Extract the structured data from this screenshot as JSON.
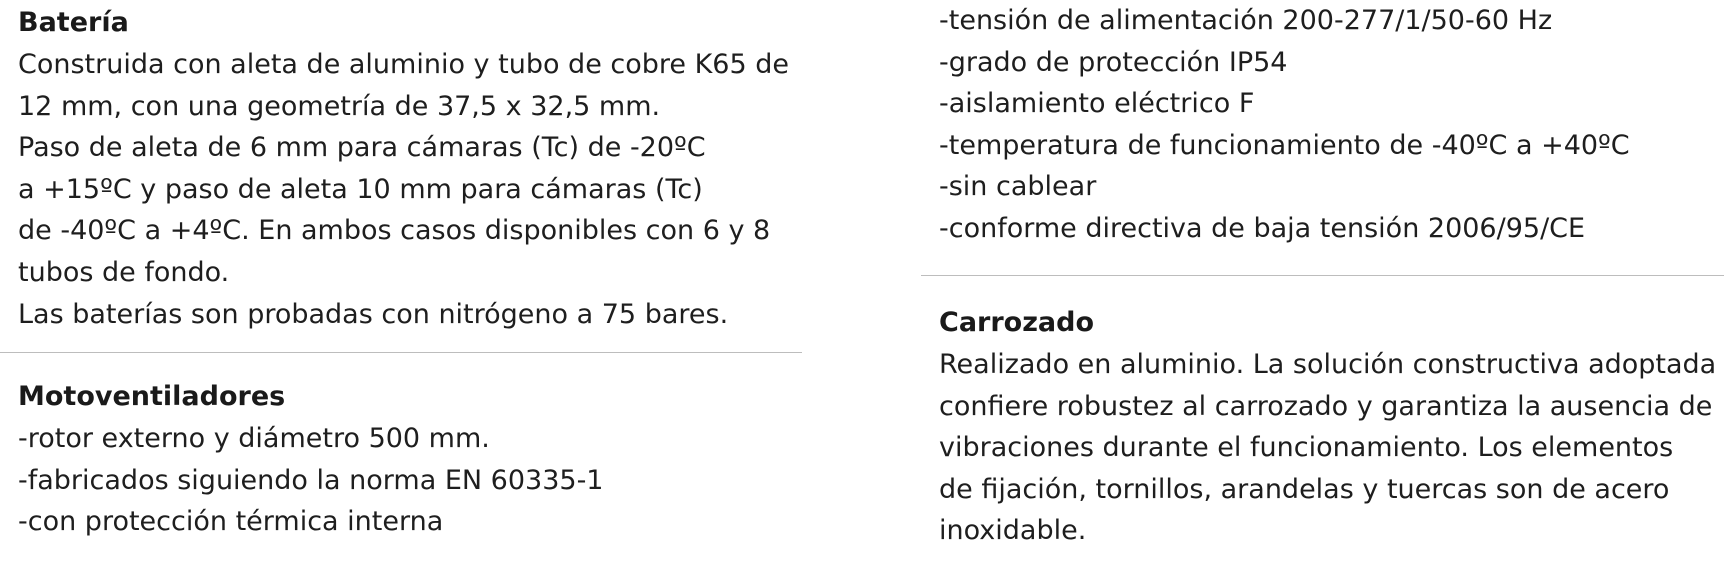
{
  "bateria": {
    "title": "Batería",
    "lines": [
      "Construida con aleta de aluminio y tubo de cobre K65 de",
      "12 mm,  con una geometría de 37,5 x 32,5 mm.",
      "Paso de aleta de 6 mm para cámaras (Tc) de -20ºC",
      "a +15ºC y paso de aleta 10 mm para cámaras (Tc)",
      "de -40ºC a +4ºC. En ambos casos disponibles con 6 y 8",
      "tubos de fondo.",
      "Las baterías son probadas con nitrógeno a 75 bares."
    ]
  },
  "motoventiladores": {
    "title": "Motoventiladores",
    "lines": [
      "-rotor externo y diámetro 500 mm.",
      "-fabricados siguiendo la norma EN 60335-1",
      "-con protección térmica interna"
    ]
  },
  "motoventiladores_cont": {
    "lines": [
      "-tensión de alimentación 200-277/1/50-60 Hz",
      "-grado de protección IP54",
      "-aislamiento eléctrico F",
      "-temperatura de funcionamiento de -40ºC a +40ºC",
      "-sin cablear",
      "-conforme directiva de baja tensión 2006/95/CE"
    ]
  },
  "carrozado": {
    "title": "Carrozado",
    "lines": [
      "Realizado en aluminio. La solución constructiva adoptada",
      "confiere robustez al carrozado y garantiza la ausencia de",
      "vibraciones durante el funcionamiento. Los elementos",
      "de fijación, tornillos, arandelas y tuercas son de acero",
      "inoxidable."
    ]
  }
}
